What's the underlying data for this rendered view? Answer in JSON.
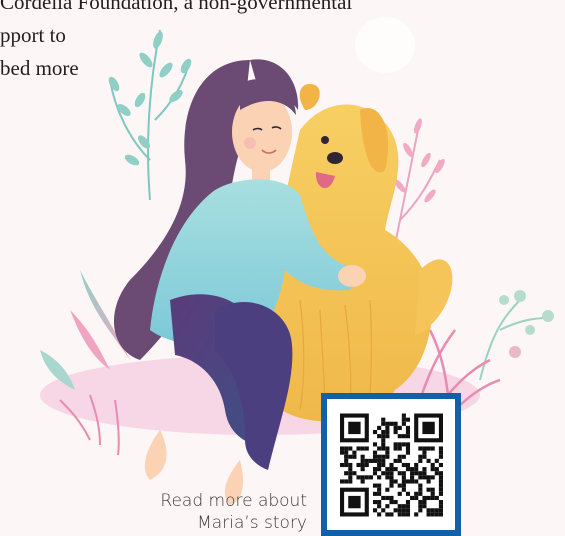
{
  "intro": {
    "lines": [
      "Cordelia Foundation, a non-governmental",
      "pport to",
      "bed more"
    ]
  },
  "caption": {
    "line1": "Read more about",
    "line2": "Maria’s story"
  },
  "qr": {
    "name": "qr-code"
  },
  "colors": {
    "background": "#fdf6f6",
    "hair": "#6b4a73",
    "sweater": "#8ccfd9",
    "pants": "#5a3c78",
    "dog": "#f5c55a",
    "skin": "#fbd3b4",
    "ground": "#f7d7e6",
    "qr_border": "#1360a8"
  }
}
